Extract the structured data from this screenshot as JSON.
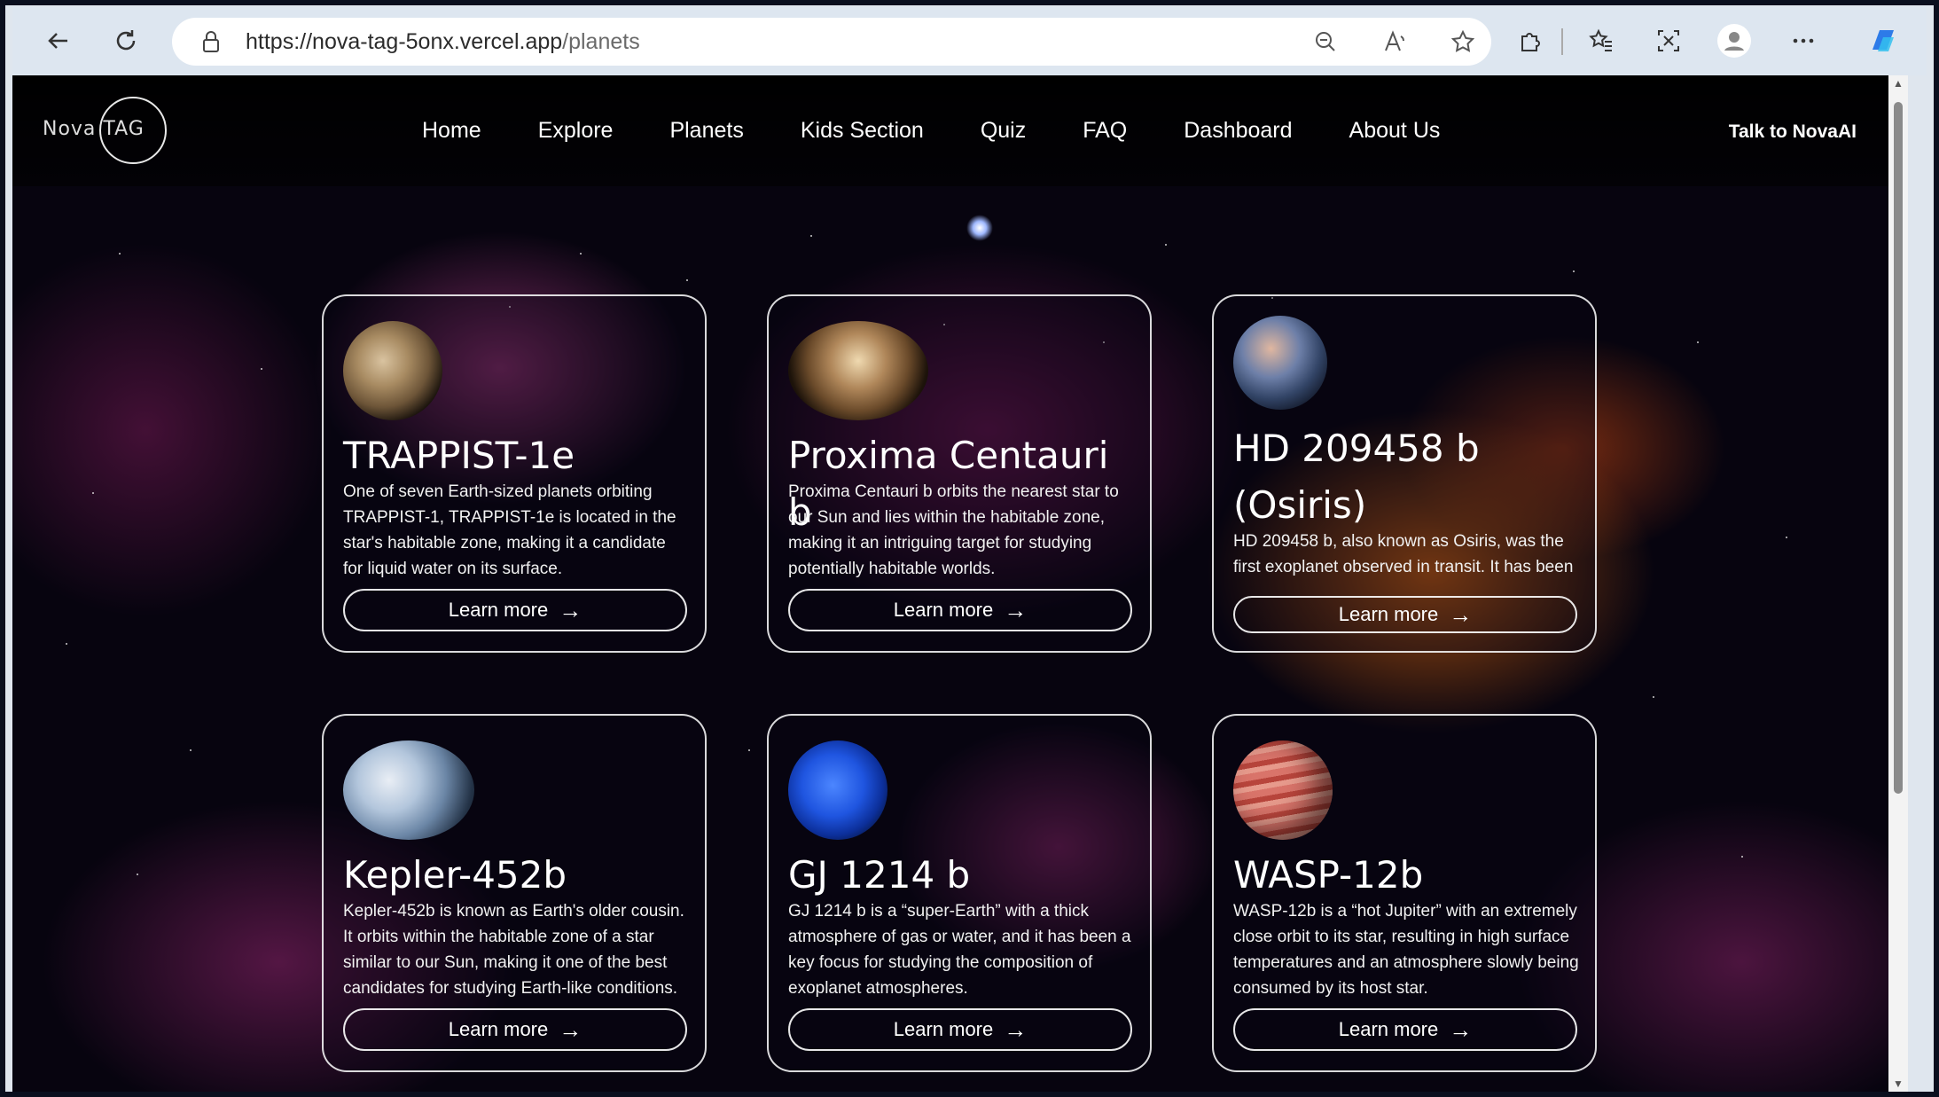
{
  "browser": {
    "url_base": "https://nova-tag-5onx.vercel.app",
    "url_path": "/planets"
  },
  "nav": {
    "logo": "Nova TAG",
    "items": [
      "Home",
      "Explore",
      "Planets",
      "Kids Section",
      "Quiz",
      "FAQ",
      "Dashboard",
      "About Us"
    ],
    "cta": "Talk to NovaAI"
  },
  "cards": [
    {
      "title": "TRAPPIST-1e",
      "text": "One of seven Earth-sized planets orbiting TRAPPIST-1, TRAPPIST-1e is located in the star's habitable zone, making it a candidate for liquid water on its surface.",
      "button": "Learn more"
    },
    {
      "title": "Proxima Centauri b",
      "text": "Proxima Centauri b orbits the nearest star to our Sun and lies within the habitable zone, making it an intriguing target for studying potentially habitable worlds.",
      "button": "Learn more"
    },
    {
      "title": "HD 209458 b (Osiris)",
      "text": "HD 209458 b, also known as Osiris, was the first exoplanet observed in transit. It has been",
      "button": "Learn more"
    },
    {
      "title": "Kepler-452b",
      "text": "Kepler-452b is known as Earth's older cousin. It orbits within the habitable zone of a star similar to our Sun, making it one of the best candidates for studying Earth-like conditions.",
      "button": "Learn more"
    },
    {
      "title": "GJ 1214 b",
      "text": "GJ 1214 b is a “super-Earth” with a thick atmosphere of gas or water, and it has been a key focus for studying the composition of exoplanet atmospheres.",
      "button": "Learn more"
    },
    {
      "title": "WASP-12b",
      "text": "WASP-12b is a “hot Jupiter” with an extremely close orbit to its star, resulting in high surface temperatures and an atmosphere slowly being consumed by its host star.",
      "button": "Learn more"
    }
  ]
}
